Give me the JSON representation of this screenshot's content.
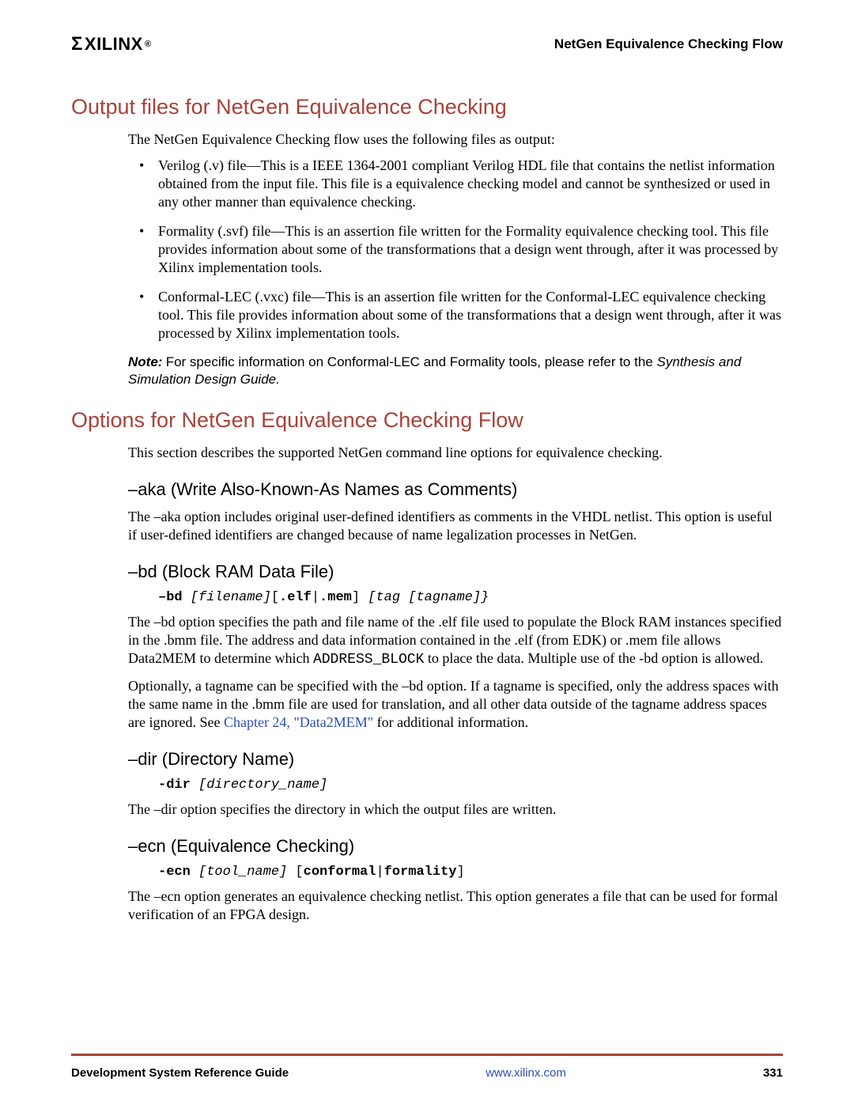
{
  "header": {
    "logo_text": "XILINX",
    "logo_reg": "®",
    "title": "NetGen Equivalence Checking Flow"
  },
  "section1": {
    "heading": "Output files for NetGen Equivalence Checking",
    "intro": "The NetGen Equivalence Checking flow uses the following files as output:",
    "bullets": [
      "Verilog (.v) file—This is a IEEE 1364-2001 compliant Verilog HDL file that contains the netlist information obtained from the input file. This file is a equivalence checking model and cannot be synthesized or used in any other manner than equivalence checking.",
      "Formality (.svf) file—This is an assertion file written for the Formality equivalence checking tool. This file provides information about some of the transformations that a design went through, after it was processed by Xilinx implementation tools.",
      "Conformal-LEC (.vxc) file—This is an assertion file written for the Conformal-LEC equivalence checking tool. This file provides information about some of the transformations that a design went through, after it was processed by Xilinx implementation tools."
    ],
    "note_label": "Note:",
    "note_body": "For specific information on Conformal-LEC and Formality tools, please refer to the",
    "note_italic": "Synthesis and Simulation Design Guide."
  },
  "section2": {
    "heading": "Options for NetGen Equivalence Checking Flow",
    "intro": "This section describes the supported NetGen command line options for equivalence checking.",
    "aka": {
      "heading": "–aka (Write Also-Known-As Names as Comments)",
      "body": "The –aka option includes original user-defined identifiers as comments in the VHDL netlist. This option is useful if user-defined identifiers are changed because of name legalization processes in NetGen."
    },
    "bd": {
      "heading": "–bd (Block RAM Data File)",
      "syntax_bold1": "–bd",
      "syntax_ital1": " [filename]",
      "syntax_plain1": "[",
      "syntax_bold2": ".elf",
      "syntax_plain2": "|",
      "syntax_bold3": ".mem",
      "syntax_plain3": "]",
      "syntax_ital2": " [tag [tagname]}",
      "p1a": "The –bd option specifies the path and file name of the .elf file used to populate the Block RAM instances specified in the .bmm file. The address and data information contained in the .elf (from EDK) or .mem file allows Data2MEM to determine which ",
      "p1_mono": "ADDRESS_BLOCK",
      "p1b": " to place the data. Multiple use of the -bd option is allowed.",
      "p2a": "Optionally, a tagname can be specified with the –bd option. If a tagname is specified, only the address spaces with the same name in the .bmm file are used for translation, and all other data outside of the tagname address spaces are ignored. See ",
      "p2_link": "Chapter 24, \"Data2MEM\"",
      "p2b": " for additional information."
    },
    "dir": {
      "heading": "–dir (Directory Name)",
      "syntax_bold": "-dir",
      "syntax_ital": " [directory_name]",
      "body": "The –dir option specifies the directory in which the output files are written."
    },
    "ecn": {
      "heading": "–ecn (Equivalence Checking)",
      "syntax_bold1": "-ecn",
      "syntax_ital": " [tool_name]",
      "syntax_plain1": " [",
      "syntax_bold2": "conformal",
      "syntax_plain2": "|",
      "syntax_bold3": "formality",
      "syntax_plain3": "]",
      "body": "The –ecn option generates an equivalence checking netlist. This option generates a file that can be used for formal verification of an FPGA design."
    }
  },
  "footer": {
    "left": "Development System Reference Guide",
    "center": "www.xilinx.com",
    "right": "331"
  }
}
